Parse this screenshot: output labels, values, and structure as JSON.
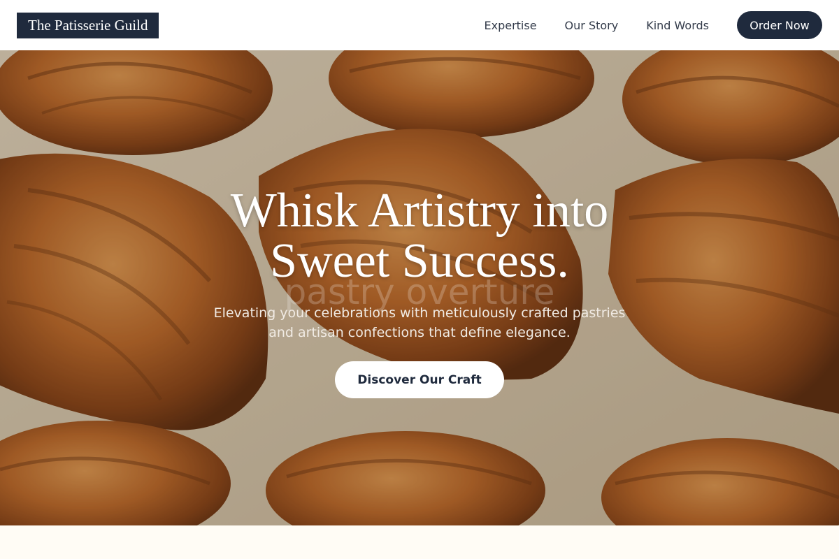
{
  "header": {
    "logo": "The Patisserie Guild",
    "nav": [
      {
        "label": "Expertise"
      },
      {
        "label": "Our Story"
      },
      {
        "label": "Kind Words"
      }
    ],
    "cta_label": "Order Now"
  },
  "hero": {
    "title_line1": "Whisk Artistry into",
    "title_line2": "Sweet Success.",
    "ghost_text": "pastry overture",
    "subtitle": "Elevating your celebrations with meticulously crafted pastries and artisan confections that define elegance.",
    "cta_label": "Discover Our Craft",
    "image_subject": "croissants-photo"
  },
  "colors": {
    "brand_navy": "#1f2a3d",
    "page_bg": "#ffffff",
    "cream": "#fffcf5"
  }
}
